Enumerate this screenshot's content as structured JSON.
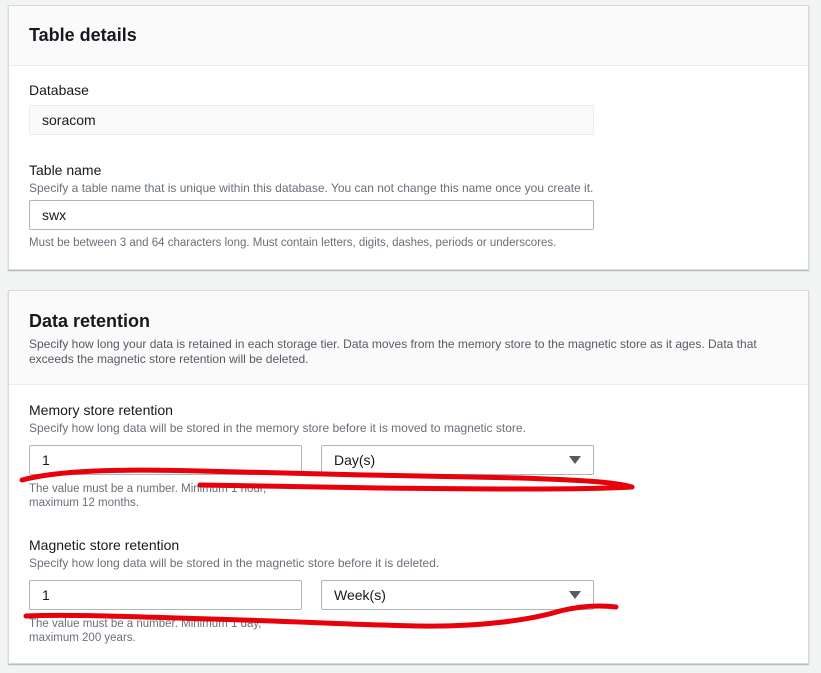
{
  "table_details": {
    "title": "Table details",
    "database": {
      "label": "Database",
      "value": "soracom"
    },
    "table_name": {
      "label": "Table name",
      "description": "Specify a table name that is unique within this database. You can not change this name once you create it.",
      "value": "swx",
      "constraint": "Must be between 3 and 64 characters long. Must contain letters, digits, dashes, periods or underscores."
    }
  },
  "data_retention": {
    "title": "Data retention",
    "description": "Specify how long your data is retained in each storage tier. Data moves from the memory store to the magnetic store as it ages. Data that exceeds the magnetic store retention will be deleted.",
    "memory_store": {
      "label": "Memory store retention",
      "description": "Specify how long data will be stored in the memory store before it is moved to magnetic store.",
      "value": "1",
      "unit": "Day(s)",
      "constraint_line1": "The value must be a number. Minimum 1 hour,",
      "constraint_line2": "maximum 12 months."
    },
    "magnetic_store": {
      "label": "Magnetic store retention",
      "description": "Specify how long data will be stored in the magnetic store before it is deleted.",
      "value": "1",
      "unit": "Week(s)",
      "constraint_line1": "The value must be a number. Minimum 1 day,",
      "constraint_line2": "maximum 200 years."
    }
  },
  "colors": {
    "annotation": "#e8000b"
  }
}
